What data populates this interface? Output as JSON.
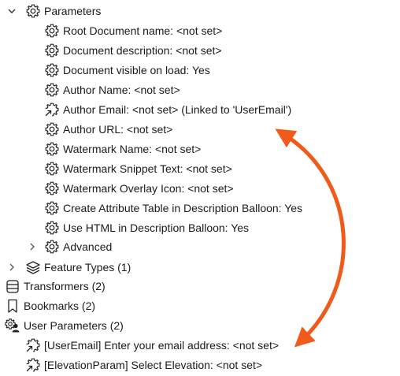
{
  "tree": {
    "parameters": {
      "label": "Parameters",
      "expanded": true,
      "children": [
        {
          "label": "Root Document name: <not set>",
          "icon": "gear-icon"
        },
        {
          "label": "Document description: <not set>",
          "icon": "gear-icon"
        },
        {
          "label": "Document visible on load: Yes",
          "icon": "gear-icon"
        },
        {
          "label": "Author Name: <not set>",
          "icon": "gear-icon"
        },
        {
          "label": "Author Email: <not set> (Linked to 'UserEmail')",
          "icon": "linked-parameter-icon"
        },
        {
          "label": "Author URL: <not set>",
          "icon": "gear-icon"
        },
        {
          "label": "Watermark Name: <not set>",
          "icon": "gear-icon"
        },
        {
          "label": "Watermark Snippet Text: <not set>",
          "icon": "gear-icon"
        },
        {
          "label": "Watermark Overlay Icon: <not set>",
          "icon": "gear-icon"
        },
        {
          "label": "Create Attribute Table in Description Balloon: Yes",
          "icon": "gear-icon"
        },
        {
          "label": "Use HTML in Description Balloon: Yes",
          "icon": "gear-icon"
        },
        {
          "label": "Advanced",
          "icon": "gear-icon",
          "collapsed": true
        }
      ]
    },
    "feature_types": {
      "label": "Feature Types (1)",
      "icon": "layers-icon",
      "collapsed": true
    },
    "transformers": {
      "label": "Transformers (2)",
      "icon": "transformers-icon"
    },
    "bookmarks": {
      "label": "Bookmarks (2)",
      "icon": "bookmark-icon"
    },
    "user_parameters": {
      "label": "User Parameters (2)",
      "icon": "user-parameters-icon",
      "children": [
        {
          "label": "[UserEmail] Enter your email address: <not set>",
          "icon": "linked-parameter-icon"
        },
        {
          "label": "[ElevationParam] Select Elevation: <not set>",
          "icon": "linked-parameter-icon"
        }
      ]
    }
  },
  "annotation": {
    "arrow_color": "#f05a1a"
  }
}
